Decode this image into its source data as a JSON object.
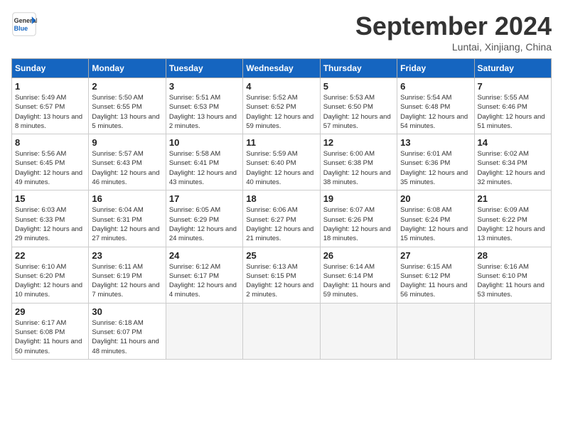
{
  "logo": {
    "line1": "General",
    "line2": "Blue"
  },
  "title": "September 2024",
  "location": "Luntai, Xinjiang, China",
  "weekdays": [
    "Sunday",
    "Monday",
    "Tuesday",
    "Wednesday",
    "Thursday",
    "Friday",
    "Saturday"
  ],
  "weeks": [
    [
      {
        "day": "1",
        "sunrise": "5:49 AM",
        "sunset": "6:57 PM",
        "daylight": "13 hours and 8 minutes."
      },
      {
        "day": "2",
        "sunrise": "5:50 AM",
        "sunset": "6:55 PM",
        "daylight": "13 hours and 5 minutes."
      },
      {
        "day": "3",
        "sunrise": "5:51 AM",
        "sunset": "6:53 PM",
        "daylight": "13 hours and 2 minutes."
      },
      {
        "day": "4",
        "sunrise": "5:52 AM",
        "sunset": "6:52 PM",
        "daylight": "12 hours and 59 minutes."
      },
      {
        "day": "5",
        "sunrise": "5:53 AM",
        "sunset": "6:50 PM",
        "daylight": "12 hours and 57 minutes."
      },
      {
        "day": "6",
        "sunrise": "5:54 AM",
        "sunset": "6:48 PM",
        "daylight": "12 hours and 54 minutes."
      },
      {
        "day": "7",
        "sunrise": "5:55 AM",
        "sunset": "6:46 PM",
        "daylight": "12 hours and 51 minutes."
      }
    ],
    [
      {
        "day": "8",
        "sunrise": "5:56 AM",
        "sunset": "6:45 PM",
        "daylight": "12 hours and 49 minutes."
      },
      {
        "day": "9",
        "sunrise": "5:57 AM",
        "sunset": "6:43 PM",
        "daylight": "12 hours and 46 minutes."
      },
      {
        "day": "10",
        "sunrise": "5:58 AM",
        "sunset": "6:41 PM",
        "daylight": "12 hours and 43 minutes."
      },
      {
        "day": "11",
        "sunrise": "5:59 AM",
        "sunset": "6:40 PM",
        "daylight": "12 hours and 40 minutes."
      },
      {
        "day": "12",
        "sunrise": "6:00 AM",
        "sunset": "6:38 PM",
        "daylight": "12 hours and 38 minutes."
      },
      {
        "day": "13",
        "sunrise": "6:01 AM",
        "sunset": "6:36 PM",
        "daylight": "12 hours and 35 minutes."
      },
      {
        "day": "14",
        "sunrise": "6:02 AM",
        "sunset": "6:34 PM",
        "daylight": "12 hours and 32 minutes."
      }
    ],
    [
      {
        "day": "15",
        "sunrise": "6:03 AM",
        "sunset": "6:33 PM",
        "daylight": "12 hours and 29 minutes."
      },
      {
        "day": "16",
        "sunrise": "6:04 AM",
        "sunset": "6:31 PM",
        "daylight": "12 hours and 27 minutes."
      },
      {
        "day": "17",
        "sunrise": "6:05 AM",
        "sunset": "6:29 PM",
        "daylight": "12 hours and 24 minutes."
      },
      {
        "day": "18",
        "sunrise": "6:06 AM",
        "sunset": "6:27 PM",
        "daylight": "12 hours and 21 minutes."
      },
      {
        "day": "19",
        "sunrise": "6:07 AM",
        "sunset": "6:26 PM",
        "daylight": "12 hours and 18 minutes."
      },
      {
        "day": "20",
        "sunrise": "6:08 AM",
        "sunset": "6:24 PM",
        "daylight": "12 hours and 15 minutes."
      },
      {
        "day": "21",
        "sunrise": "6:09 AM",
        "sunset": "6:22 PM",
        "daylight": "12 hours and 13 minutes."
      }
    ],
    [
      {
        "day": "22",
        "sunrise": "6:10 AM",
        "sunset": "6:20 PM",
        "daylight": "12 hours and 10 minutes."
      },
      {
        "day": "23",
        "sunrise": "6:11 AM",
        "sunset": "6:19 PM",
        "daylight": "12 hours and 7 minutes."
      },
      {
        "day": "24",
        "sunrise": "6:12 AM",
        "sunset": "6:17 PM",
        "daylight": "12 hours and 4 minutes."
      },
      {
        "day": "25",
        "sunrise": "6:13 AM",
        "sunset": "6:15 PM",
        "daylight": "12 hours and 2 minutes."
      },
      {
        "day": "26",
        "sunrise": "6:14 AM",
        "sunset": "6:14 PM",
        "daylight": "11 hours and 59 minutes."
      },
      {
        "day": "27",
        "sunrise": "6:15 AM",
        "sunset": "6:12 PM",
        "daylight": "11 hours and 56 minutes."
      },
      {
        "day": "28",
        "sunrise": "6:16 AM",
        "sunset": "6:10 PM",
        "daylight": "11 hours and 53 minutes."
      }
    ],
    [
      {
        "day": "29",
        "sunrise": "6:17 AM",
        "sunset": "6:08 PM",
        "daylight": "11 hours and 50 minutes."
      },
      {
        "day": "30",
        "sunrise": "6:18 AM",
        "sunset": "6:07 PM",
        "daylight": "11 hours and 48 minutes."
      },
      null,
      null,
      null,
      null,
      null
    ]
  ]
}
